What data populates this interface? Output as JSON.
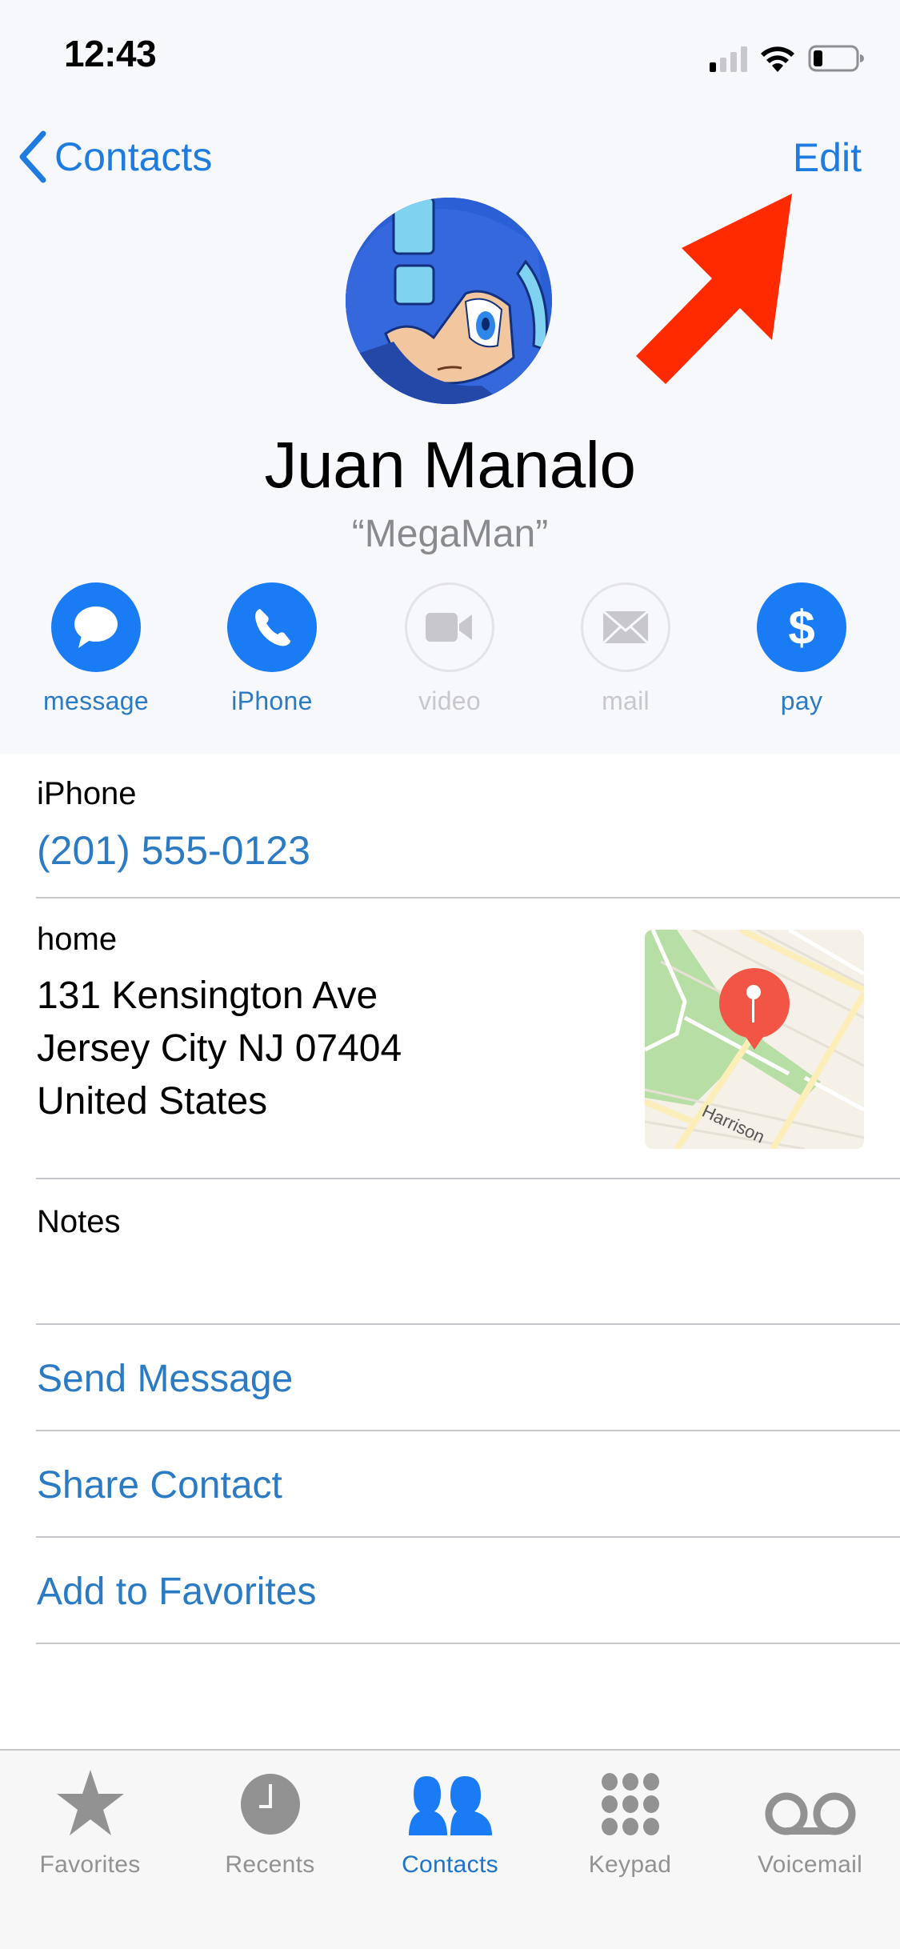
{
  "status_bar": {
    "time": "12:43",
    "signal_bars_active": 1,
    "signal_bars_total": 4,
    "battery_level": 0.2
  },
  "nav": {
    "back_label": "Contacts",
    "edit_label": "Edit"
  },
  "contact": {
    "name": "Juan Manalo",
    "nickname": "“MegaMan”",
    "avatar_icon": "megaman-avatar"
  },
  "annotation": {
    "arrow_color": "#ff2a00",
    "points_to": "Edit"
  },
  "actions": [
    {
      "label": "message",
      "icon": "message-bubble-icon",
      "enabled": true
    },
    {
      "label": "iPhone",
      "icon": "phone-icon",
      "enabled": true
    },
    {
      "label": "video",
      "icon": "video-camera-icon",
      "enabled": false
    },
    {
      "label": "mail",
      "icon": "envelope-icon",
      "enabled": false
    },
    {
      "label": "pay",
      "icon": "dollar-icon",
      "enabled": true
    }
  ],
  "phone": {
    "label": "iPhone",
    "value": "(201) 555-0123"
  },
  "address": {
    "label": "home",
    "line1": "131 Kensington Ave",
    "line2": "Jersey City NJ 07404",
    "line3": "United States",
    "map_street_label": "Harrison"
  },
  "notes": {
    "label": "Notes",
    "value": ""
  },
  "row_actions": [
    {
      "label": "Send Message"
    },
    {
      "label": "Share Contact"
    },
    {
      "label": "Add to Favorites"
    }
  ],
  "tabs": [
    {
      "label": "Favorites",
      "icon": "star-icon",
      "active": false
    },
    {
      "label": "Recents",
      "icon": "clock-icon",
      "active": false
    },
    {
      "label": "Contacts",
      "icon": "contacts-icon",
      "active": true
    },
    {
      "label": "Keypad",
      "icon": "keypad-icon",
      "active": false
    },
    {
      "label": "Voicemail",
      "icon": "voicemail-icon",
      "active": false
    }
  ],
  "colors": {
    "accent": "#1a7cf4",
    "link_text": "#2b7bc4",
    "header_bg": "#f7f8fc",
    "disabled": "#c8c8cc"
  }
}
